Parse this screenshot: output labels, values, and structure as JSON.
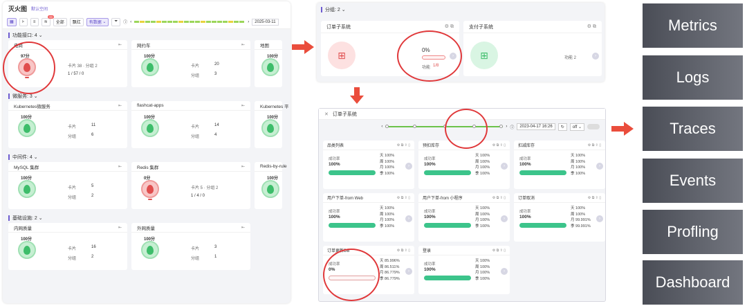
{
  "left": {
    "title": "灭火图",
    "subtitle": "默认空间",
    "toolbar": {
      "all": "全部",
      "red": "飘红",
      "selected": "有数据",
      "date": "2025-03-11",
      "badge": "99"
    },
    "groups": [
      {
        "title": "功能接口: 4",
        "cards": [
          {
            "name": "电商",
            "score": "97分",
            "l1": "卡片 38 · 分组 2",
            "l2": "1 / 57 / 0",
            "red": true
          },
          {
            "name": "网约车",
            "score": "100分",
            "k1": "卡片",
            "v1": "20",
            "k2": "分组",
            "v2": "3"
          },
          {
            "name": "地图",
            "score": "100分"
          }
        ]
      },
      {
        "title": "微服务: 3",
        "cards": [
          {
            "name": "Kubernetes微服务",
            "score": "100分",
            "k1": "卡片",
            "v1": "11",
            "k2": "分组",
            "v2": "6"
          },
          {
            "name": "flashcat-apps",
            "score": "100分",
            "k1": "卡片",
            "v1": "14",
            "k2": "分组",
            "v2": "4"
          },
          {
            "name": "Kubernetes 平",
            "score": "100分"
          }
        ]
      },
      {
        "title": "中间件: 4",
        "cards": [
          {
            "name": "MySQL 集群",
            "score": "100分",
            "k1": "卡片",
            "v1": "5",
            "k2": "分组",
            "v2": "2"
          },
          {
            "name": "Redis 集群",
            "score": "0分",
            "l1": "卡片 5 · 分组 2",
            "l2": "1 / 4 / 0",
            "red": true
          },
          {
            "name": "Redis-by-rule",
            "score": "100分"
          }
        ]
      },
      {
        "title": "基础设施: 2",
        "cards": [
          {
            "name": "内网质量",
            "score": "100分",
            "k1": "卡片",
            "v1": "16",
            "k2": "分组",
            "v2": "2"
          },
          {
            "name": "外网质量",
            "score": "100分",
            "k1": "卡片",
            "v1": "3",
            "k2": "分组",
            "v2": "1"
          }
        ]
      }
    ]
  },
  "mtop": {
    "group_title": "分组: 2",
    "card1": {
      "name": "订单子系统",
      "pct": "0%",
      "func_label": "功能",
      "func_val": "1/8"
    },
    "card2": {
      "name": "支付子系统",
      "func": "功能 2"
    }
  },
  "mbot": {
    "title": "订单子系统",
    "date": "2023-04-17 16:26",
    "refresh": "off",
    "cards": [
      {
        "name": "品类列表",
        "label": "成功率",
        "value": "100%",
        "s": [
          "天 100%",
          "周 100%",
          "月 100%",
          "季 100%"
        ],
        "ok": true
      },
      {
        "name": "预扣库存",
        "label": "成功率",
        "value": "100%",
        "s": [
          "天 100%",
          "周 100%",
          "月 100%",
          "季 100%"
        ],
        "ok": true
      },
      {
        "name": "扣减库存",
        "label": "成功率",
        "value": "100%",
        "s": [
          "天 100%",
          "周 100%",
          "月 100%",
          "季 100%"
        ],
        "ok": true
      },
      {
        "name": "用户下单-from Web",
        "label": "成功率",
        "value": "100%",
        "s": [
          "天 100%",
          "周 100%",
          "月 100%",
          "季 100%"
        ],
        "ok": true
      },
      {
        "name": "用户下单-from 小程序",
        "label": "成功率",
        "value": "100%",
        "s": [
          "天 100%",
          "周 100%",
          "月 100%",
          "季 100%"
        ],
        "ok": true
      },
      {
        "name": "订单取消",
        "label": "成功率",
        "value": "100%",
        "s": [
          "天 100%",
          "周 100%",
          "月 99.991%",
          "季 99.991%"
        ],
        "ok": true
      },
      {
        "name": "订单更新DB",
        "label": "成功率",
        "value": "0%",
        "s": [
          "天 85.996%",
          "周 86.511%",
          "月 86.779%",
          "季 86.779%"
        ],
        "ok": false
      },
      {
        "name": "登录",
        "label": "成功率",
        "value": "100%",
        "s": [
          "天 100%",
          "周 100%",
          "月 100%",
          "季 100%"
        ],
        "ok": true
      }
    ]
  },
  "right_items": [
    "Metrics",
    "Logs",
    "Traces",
    "Events",
    "Profling",
    "Dashboard"
  ],
  "colors": {
    "accent": "#6d5bd0",
    "alert": "#e0383a",
    "ok": "#3cc48b"
  }
}
